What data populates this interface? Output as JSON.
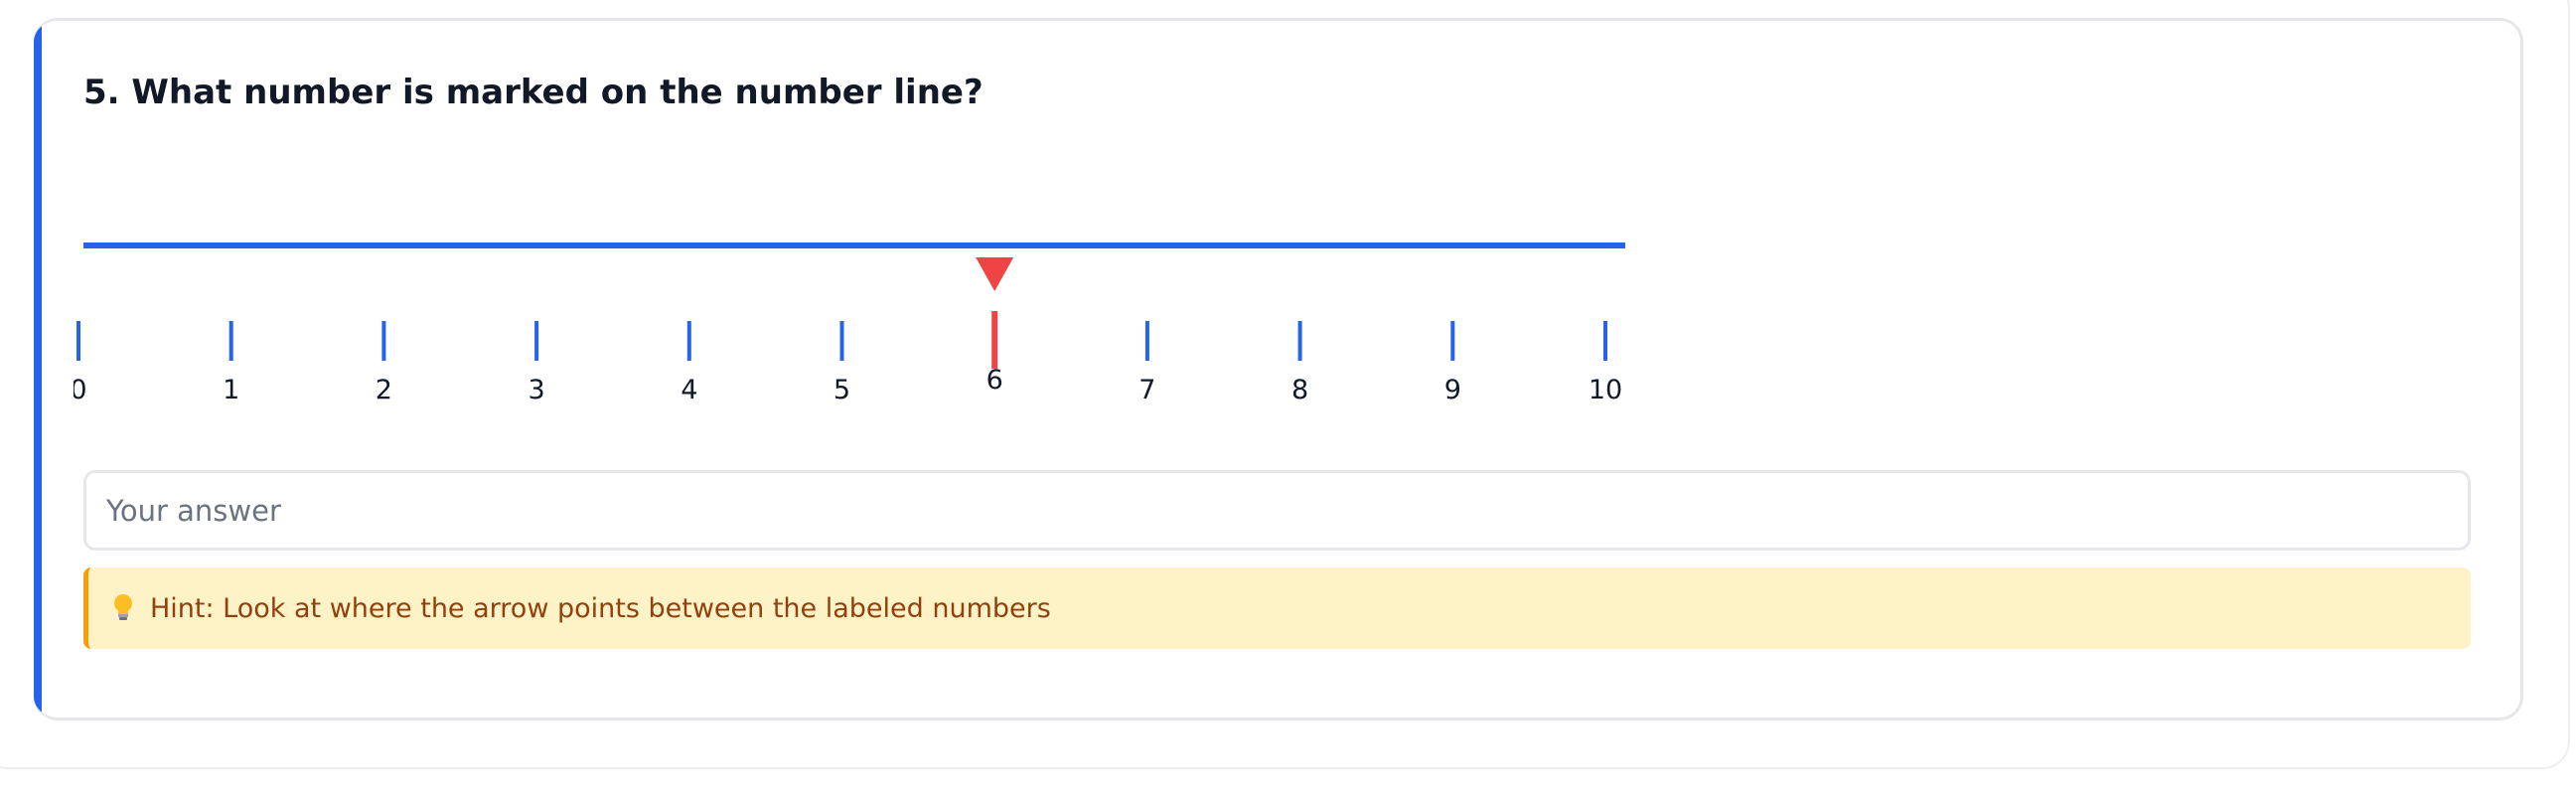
{
  "question": {
    "title": "5. What number is marked on the number line?"
  },
  "number_line": {
    "min": 0,
    "max": 10,
    "tick_labels": [
      "0",
      "1",
      "2",
      "3",
      "4",
      "5",
      "6",
      "7",
      "8",
      "9",
      "10"
    ],
    "marked_value": 6
  },
  "answer": {
    "placeholder": "Your answer",
    "value": ""
  },
  "hint": {
    "icon": "lightbulb-icon",
    "text": "Hint: Look at where the arrow points between the labeled numbers"
  },
  "colors": {
    "accent": "#2563eb",
    "marker": "#ef4444",
    "hint_background": "#fef3c7",
    "hint_border": "#f59e0b",
    "hint_text": "#92400e"
  }
}
